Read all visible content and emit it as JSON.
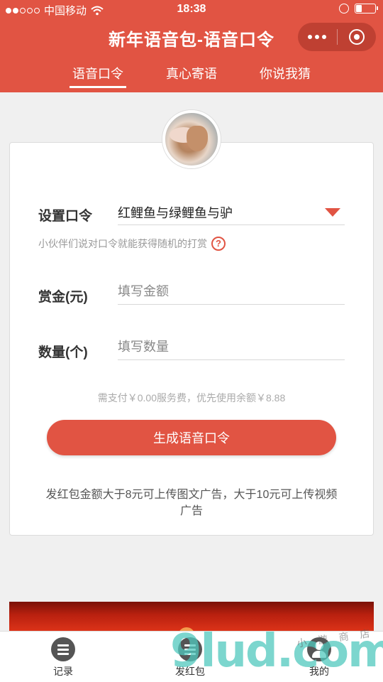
{
  "status_bar": {
    "carrier": "中国移动",
    "time": "18:38",
    "battery_level": 0.3,
    "icons": [
      "signal-dots-icon",
      "wifi-icon",
      "orientation-lock-icon",
      "battery-icon"
    ]
  },
  "header": {
    "title": "新年语音包-语音口令",
    "background_color": "#e15443",
    "capsule": {
      "more_icon": "more-dots-icon",
      "close_icon": "target-circle-icon"
    }
  },
  "tabs": [
    {
      "label": "语音口令",
      "active": true
    },
    {
      "label": "真心寄语",
      "active": false
    },
    {
      "label": "你说我猜",
      "active": false
    }
  ],
  "form": {
    "password": {
      "label": "设置口令",
      "value": "红鲤鱼与绿鲤鱼与驴",
      "hint": "小伙伴们说对口令就能获得随机的打赏",
      "help_glyph": "?"
    },
    "amount": {
      "label": "赏金(元)",
      "placeholder": "填写金额"
    },
    "quantity": {
      "label": "数量(个)",
      "placeholder": "填写数量"
    },
    "fee_text": "需支付￥0.00服务费，优先使用余额￥8.88",
    "submit_label": "生成语音口令",
    "note": "发红包金额大于8元可上传图文广告，大于10元可上传视频广告"
  },
  "tab_bar": {
    "items": [
      {
        "label": "记录",
        "icon": "list-icon"
      },
      {
        "label": "发红包",
        "icon": "list-icon"
      },
      {
        "label": "我的",
        "icon": "user-icon"
      }
    ]
  },
  "watermark": {
    "text": "9lud.com",
    "small_text": "小 游 商 店"
  },
  "accent_color": "#e15443"
}
